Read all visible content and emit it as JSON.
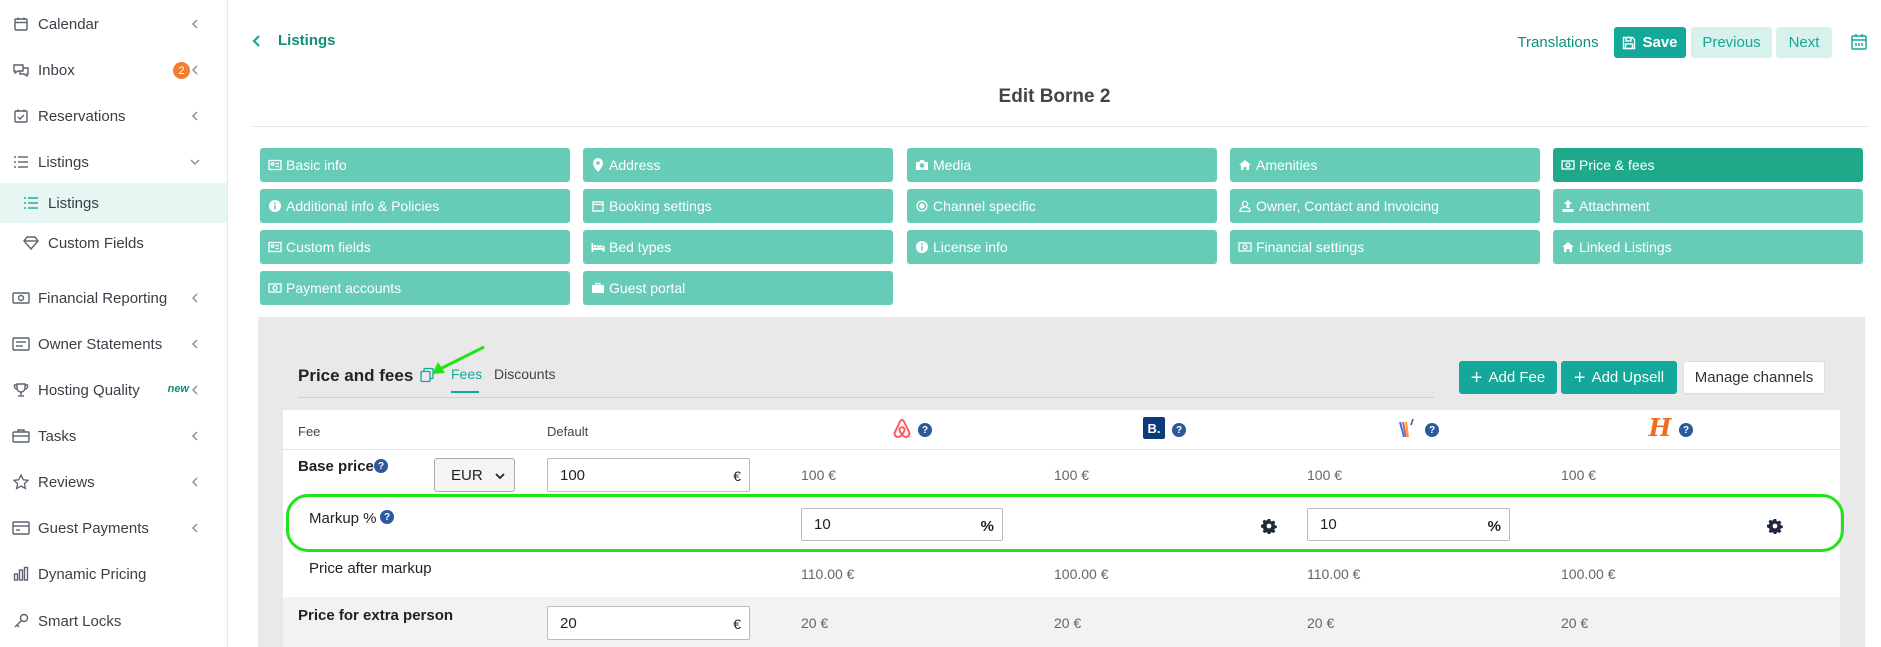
{
  "sidebar": {
    "items": [
      {
        "label": "Calendar",
        "icon": "calendar-icon"
      },
      {
        "label": "Inbox",
        "icon": "inbox-icon",
        "badge": "2"
      },
      {
        "label": "Reservations",
        "icon": "reservations-icon"
      },
      {
        "label": "Listings",
        "icon": "list-icon"
      },
      {
        "label": "Listings",
        "icon": "list-icon"
      },
      {
        "label": "Custom Fields",
        "icon": "diamond-icon"
      },
      {
        "label": "Financial Reporting",
        "icon": "money-icon"
      },
      {
        "label": "Owner Statements",
        "icon": "statement-icon"
      },
      {
        "label": "Hosting Quality",
        "icon": "trophy-icon",
        "tag": "new"
      },
      {
        "label": "Tasks",
        "icon": "tasks-icon"
      },
      {
        "label": "Reviews",
        "icon": "star-icon"
      },
      {
        "label": "Guest Payments",
        "icon": "card-icon"
      },
      {
        "label": "Dynamic Pricing",
        "icon": "chart-icon"
      },
      {
        "label": "Smart Locks",
        "icon": "key-icon"
      }
    ]
  },
  "header": {
    "back_label": "Listings",
    "translations": "Translations",
    "save": "Save",
    "previous": "Previous",
    "next": "Next",
    "title": "Edit Borne 2"
  },
  "tabs": [
    {
      "label": "Basic info",
      "icon": "id-card-icon"
    },
    {
      "label": "Address",
      "icon": "map-pin-icon"
    },
    {
      "label": "Media",
      "icon": "camera-icon"
    },
    {
      "label": "Amenities",
      "icon": "home-icon"
    },
    {
      "label": "Price & fees",
      "icon": "money-icon"
    },
    {
      "label": "Additional info & Policies",
      "icon": "info-icon"
    },
    {
      "label": "Booking settings",
      "icon": "calendar-icon"
    },
    {
      "label": "Channel specific",
      "icon": "circle-icon"
    },
    {
      "label": "Owner, Contact and Invoicing",
      "icon": "user-icon"
    },
    {
      "label": "Attachment",
      "icon": "upload-icon"
    },
    {
      "label": "Custom fields",
      "icon": "id-card-icon"
    },
    {
      "label": "Bed types",
      "icon": "bed-icon"
    },
    {
      "label": "License info",
      "icon": "info-icon"
    },
    {
      "label": "Financial settings",
      "icon": "money-icon"
    },
    {
      "label": "Linked Listings",
      "icon": "home-icon"
    },
    {
      "label": "Payment accounts",
      "icon": "money-icon"
    },
    {
      "label": "Guest portal",
      "icon": "briefcase-icon"
    }
  ],
  "section": {
    "title": "Price and fees",
    "subtabs": {
      "fees": "Fees",
      "discounts": "Discounts"
    },
    "add_fee": "Add Fee",
    "add_upsell": "Add Upsell",
    "manage_channels": "Manage channels"
  },
  "table": {
    "headers": {
      "fee": "Fee",
      "default": "Default"
    },
    "channels": [
      "airbnb-logo-icon",
      "booking-logo-icon",
      "vrbo-logo-icon",
      "homeaway-logo-icon"
    ],
    "channel_glyphs": {
      "booking": "B.",
      "homeaway": "H"
    },
    "base_price": {
      "label": "Base price",
      "currency": "EUR",
      "default": "100",
      "suffix": "€",
      "values": [
        "100 €",
        "100 €",
        "100 €",
        "100 €"
      ]
    },
    "markup": {
      "label": "Markup %",
      "airbnb": "10",
      "vrbo": "10",
      "suffix": "%"
    },
    "price_after_markup": {
      "label": "Price after markup",
      "values": [
        "110.00 €",
        "100.00 €",
        "110.00 €",
        "100.00 €"
      ]
    },
    "extra_person": {
      "label": "Price for extra person",
      "default": "20",
      "suffix": "€",
      "values": [
        "20 €",
        "20 €",
        "20 €",
        "20 €"
      ]
    }
  },
  "colors": {
    "accent": "#13a89a",
    "tab_bg": "#66ccb7",
    "tab_active": "#1fa889",
    "highlight": "#22e31a",
    "badge": "#f47e2f"
  }
}
